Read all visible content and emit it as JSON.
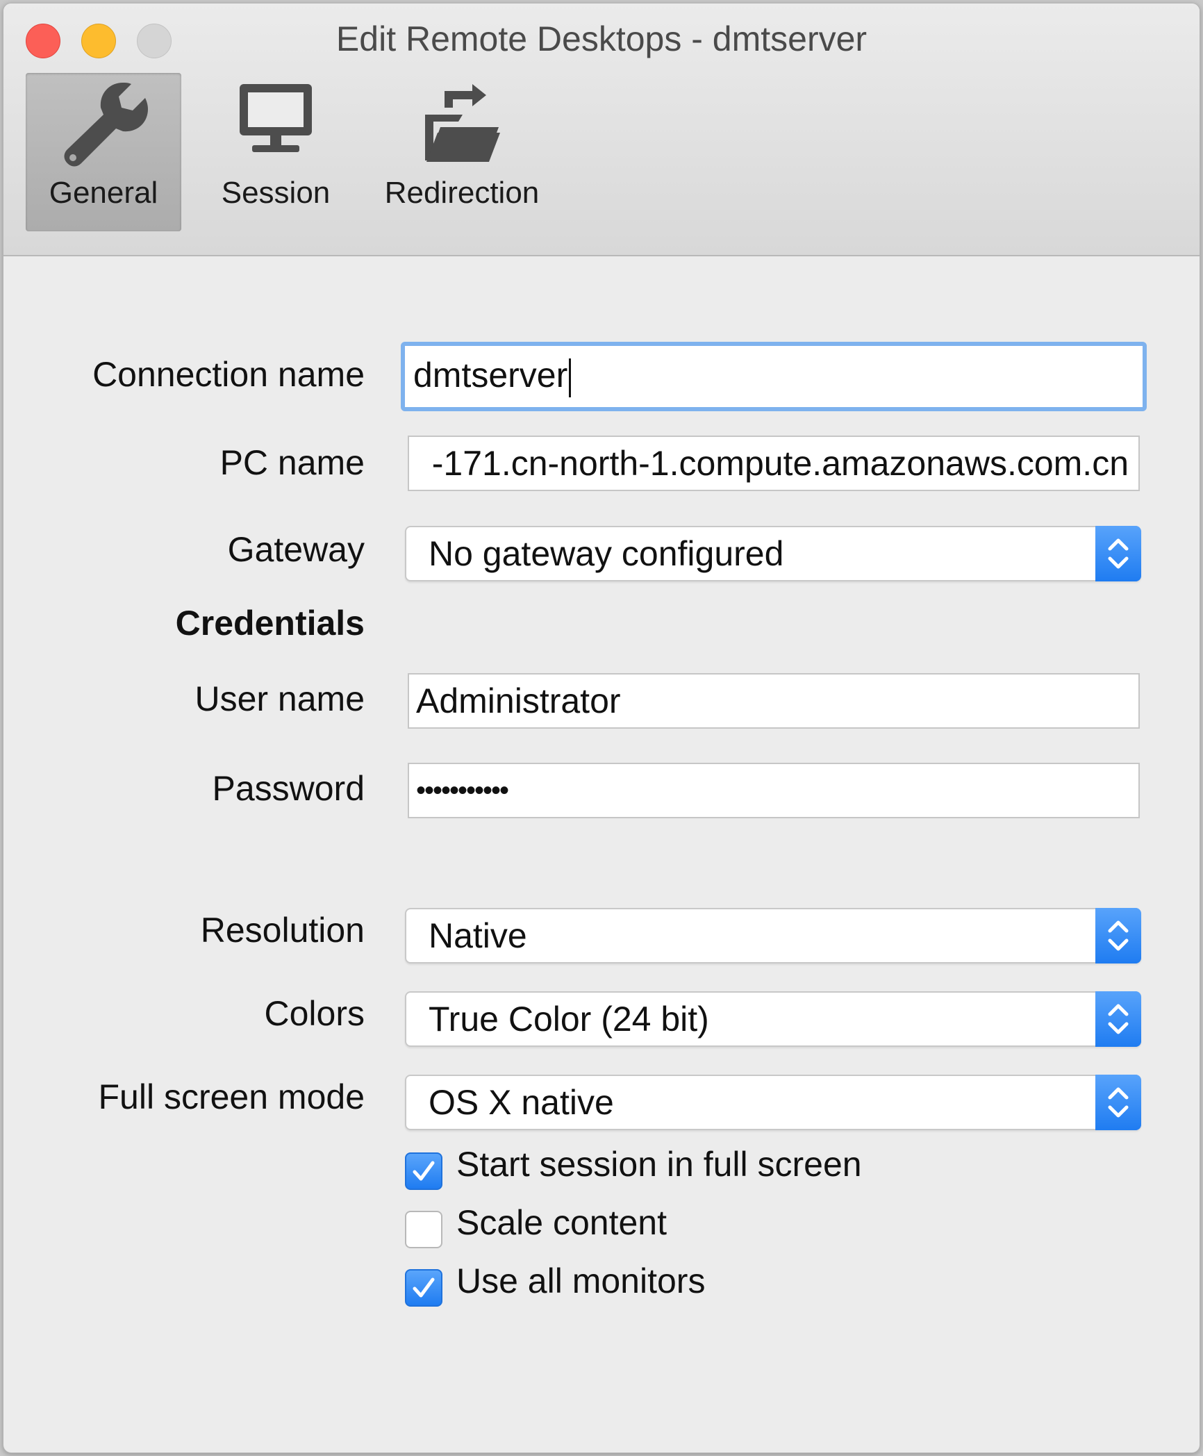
{
  "window": {
    "title": "Edit Remote Desktops - dmtserver"
  },
  "toolbar": {
    "items": [
      {
        "label": "General",
        "icon": "wrench-icon",
        "selected": true
      },
      {
        "label": "Session",
        "icon": "monitor-icon",
        "selected": false
      },
      {
        "label": "Redirection",
        "icon": "folder-redirect-icon",
        "selected": false
      }
    ]
  },
  "form": {
    "connection_name": {
      "label": "Connection name",
      "value": "dmtserver"
    },
    "pc_name": {
      "label": "PC name",
      "value": "-171.cn-north-1.compute.amazonaws.com.cn"
    },
    "gateway": {
      "label": "Gateway",
      "value": "No gateway configured"
    },
    "credentials_heading": "Credentials",
    "user_name": {
      "label": "User name",
      "value": "Administrator"
    },
    "password": {
      "label": "Password",
      "value": "•••••••••••"
    },
    "resolution": {
      "label": "Resolution",
      "value": "Native"
    },
    "colors": {
      "label": "Colors",
      "value": "True Color (24 bit)"
    },
    "full_screen_mode": {
      "label": "Full screen mode",
      "value": "OS X native"
    },
    "checkboxes": [
      {
        "label": "Start session in full screen",
        "checked": true
      },
      {
        "label": "Scale content",
        "checked": false
      },
      {
        "label": "Use all monitors",
        "checked": true
      }
    ]
  },
  "colors": {
    "accent": "#1f7cf1",
    "focus_ring": "#7eb2ee",
    "close": "#fc5f57",
    "minimize": "#fdbc2e"
  }
}
